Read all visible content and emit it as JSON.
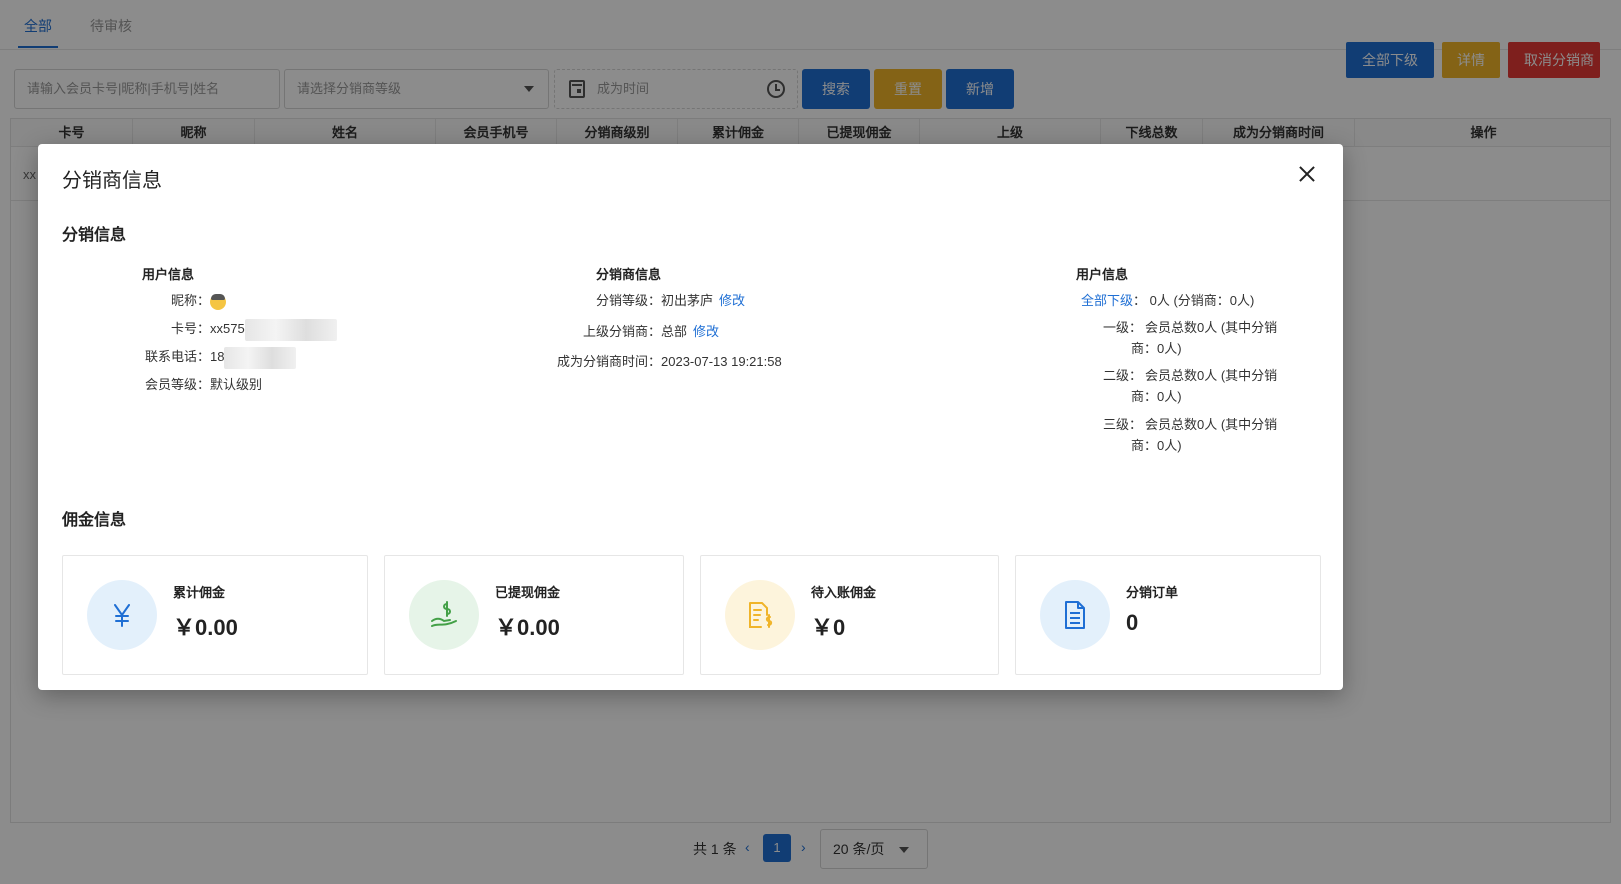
{
  "tabs": [
    "全部",
    "待审核"
  ],
  "filters": {
    "keyword_placeholder": "请输入会员卡号|昵称|手机号|姓名",
    "level_placeholder": "请选择分销商等级",
    "time_placeholder": "成为时间"
  },
  "buttons": {
    "search": "搜索",
    "reset": "重置",
    "add": "新增"
  },
  "table": {
    "headers": [
      "卡号",
      "昵称",
      "姓名",
      "会员手机号",
      "分销商级别",
      "累计佣金",
      "已提现佣金",
      "上级",
      "下线总数",
      "成为分销商时间",
      "操作"
    ],
    "row_card": "xx",
    "actions": [
      "全部下级",
      "详情",
      "取消分销商"
    ]
  },
  "pagination": {
    "total": "共 1 条",
    "page": "1",
    "page_size": "20 条/页"
  },
  "modal": {
    "title": "分销商信息",
    "section_distribution": "分销信息",
    "user_info": {
      "heading": "用户信息",
      "nickname_label": "昵称：",
      "card_label": "卡号：",
      "card_value": "xx575",
      "phone_label": "联系电话：",
      "phone_value": "18",
      "level_label": "会员等级：",
      "level_value": "默认级别"
    },
    "distributor_info": {
      "heading": "分销商信息",
      "grade_label": "分销等级：",
      "grade_value": "初出茅庐",
      "grade_edit": "修改",
      "parent_label": "上级分销商：",
      "parent_value": "总部",
      "parent_edit": "修改",
      "time_label": "成为分销商时间：",
      "time_value": "2023-07-13 19:21:58"
    },
    "downline_info": {
      "heading": "用户信息",
      "all_link": "全部下级",
      "all_value": "：  0人 (分销商：0人)",
      "level1_label": "一级：",
      "level1_line1": "会员总数0人 (其中分销",
      "level1_line2": "商：0人)",
      "level2_label": "二级：",
      "level2_line1": "会员总数0人 (其中分销",
      "level2_line2": "商：0人)",
      "level3_label": "三级：",
      "level3_line1": "会员总数0人 (其中分销",
      "level3_line2": "商：0人)"
    },
    "section_commission": "佣金信息",
    "cards": [
      {
        "label": "累计佣金",
        "value": "￥0.00",
        "icon": "yen-icon",
        "color": "#1f6fd4"
      },
      {
        "label": "已提现佣金",
        "value": "￥0.00",
        "icon": "money-hand-icon",
        "color": "#43a047"
      },
      {
        "label": "待入账佣金",
        "value": "￥0",
        "icon": "document-dollar-icon",
        "color": "#f0b429"
      },
      {
        "label": "分销订单",
        "value": "0",
        "icon": "document-icon",
        "color": "#1f6fd4"
      }
    ]
  }
}
